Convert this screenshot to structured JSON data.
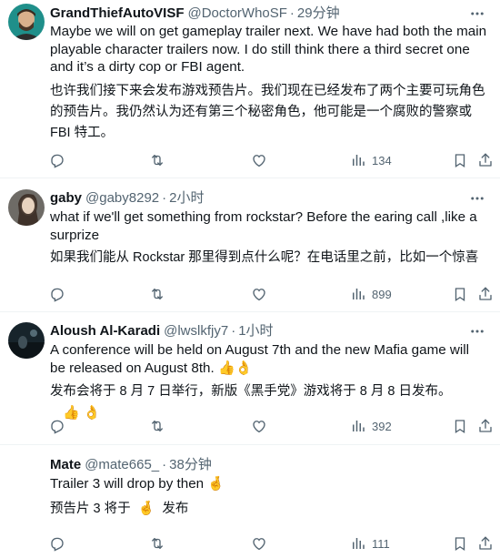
{
  "tweets": [
    {
      "name": "GrandThiefAutoVISF",
      "handle": "@DoctorWhoSF",
      "dot": "·",
      "time": "29分钟",
      "text_en": "Maybe we will on get gameplay trailer next. We have had both the main playable character trailers now. I do still think there a third secret one and it’s a dirty cop or FBI agent.",
      "text_zh": "也许我们接下来会发布游戏预告片。我们现在已经发布了两个主要可玩角色的预告片。我仍然认为还有第三个秘密角色，他可能是一个腐败的警察或 FBI 特工。",
      "views": "134"
    },
    {
      "name": "gaby",
      "handle": "@gaby8292",
      "dot": "·",
      "time": "2小时",
      "text_en": "what if we'll get something from rockstar? Before the earing call ,like a surprize",
      "text_zh": "如果我们能从 Rockstar 那里得到点什么呢？在电话里之前，比如一个惊喜",
      "views": "899"
    },
    {
      "name": "Aloush Al-Karadi",
      "handle": "@lwslkfjy7",
      "dot": "·",
      "time": "1小时",
      "text_en": "A conference will be held on August 7th and the new Mafia game will be released on August 8th.",
      "text_en_emoji": "👍👌",
      "text_zh": "发布会将于 8 月 7 日举行，新版《黑手党》游戏将于 8 月 8 日发布。",
      "text_zh_emoji": "👍 👌",
      "views": "392"
    },
    {
      "name": "Mate",
      "handle": "@mate665_",
      "dot": "·",
      "time": "38分钟",
      "text_en": "Trailer 3 will drop by then",
      "text_en_emoji": "🤞",
      "text_zh": "预告片 3 将于",
      "text_zh_emoji": "🤞",
      "text_zh_tail": "发布",
      "views": "111"
    }
  ],
  "colors": {
    "text": "#0f1419",
    "secondary": "#536471",
    "divider": "#eff3f4"
  },
  "icons": [
    "more-icon",
    "reply-icon",
    "retweet-icon",
    "like-icon",
    "views-icon",
    "bookmark-icon",
    "share-icon"
  ]
}
